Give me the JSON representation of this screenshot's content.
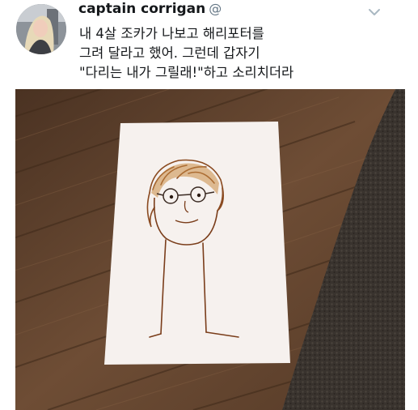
{
  "tweet": {
    "display_name": "captain corrigan",
    "handle": "@",
    "text_lines": [
      "내 4살 조카가 나보고 해리포터를",
      "그려 달라고 했어. 그런데 갑자기",
      "\"다리는 내가 그릴래!\"하고 소리치더라"
    ],
    "icons": {
      "more": "chevron-down-icon",
      "avatar": "avatar"
    }
  },
  "colors": {
    "text": "#14171a",
    "secondary": "#657786",
    "floor": "#6b4a33",
    "rug": "#3a342f",
    "paper": "#f6f1ee",
    "marker": "#7a3d1a"
  }
}
